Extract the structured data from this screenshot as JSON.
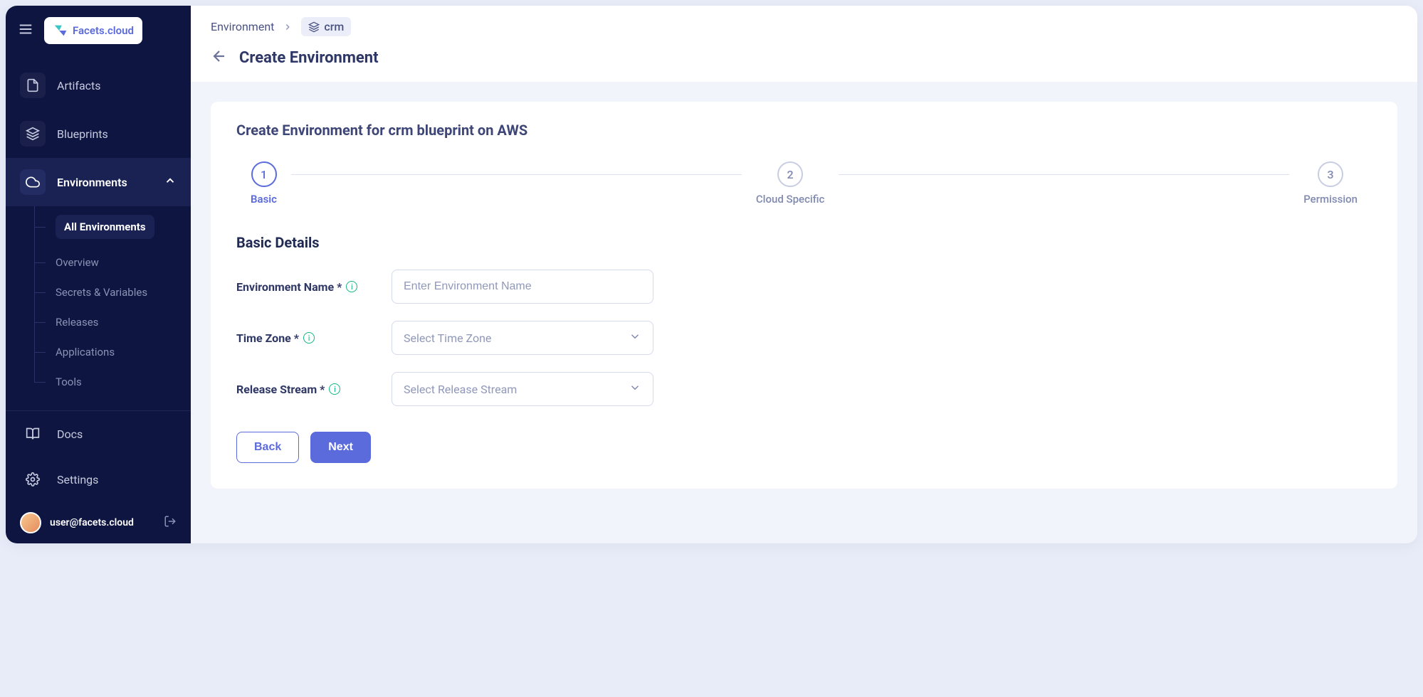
{
  "logo": {
    "text": "Facets.cloud"
  },
  "sidebar": {
    "items": [
      {
        "label": "Artifacts"
      },
      {
        "label": "Blueprints"
      },
      {
        "label": "Environments"
      }
    ],
    "subitems": [
      {
        "label": "All Environments"
      },
      {
        "label": "Overview"
      },
      {
        "label": "Secrets & Variables"
      },
      {
        "label": "Releases"
      },
      {
        "label": "Applications"
      },
      {
        "label": "Tools"
      }
    ],
    "bottom": [
      {
        "label": "Docs"
      },
      {
        "label": "Settings"
      }
    ]
  },
  "user": {
    "email": "user@facets.cloud"
  },
  "breadcrumb": {
    "root": "Environment",
    "tag": "crm"
  },
  "page": {
    "title": "Create Environment",
    "card_title_prefix": "Create Environment for ",
    "card_title_blueprint": "crm",
    "card_title_suffix": " blueprint on AWS"
  },
  "stepper": {
    "steps": [
      {
        "num": "1",
        "label": "Basic"
      },
      {
        "num": "2",
        "label": "Cloud Specific"
      },
      {
        "num": "3",
        "label": "Permission"
      }
    ]
  },
  "form": {
    "section": "Basic Details",
    "fields": {
      "env_name": {
        "label": "Environment Name *",
        "placeholder": "Enter Environment Name"
      },
      "tz": {
        "label": "Time Zone *",
        "placeholder": "Select Time Zone"
      },
      "release": {
        "label": "Release Stream *",
        "placeholder": "Select Release Stream"
      }
    },
    "buttons": {
      "back": "Back",
      "next": "Next"
    }
  }
}
